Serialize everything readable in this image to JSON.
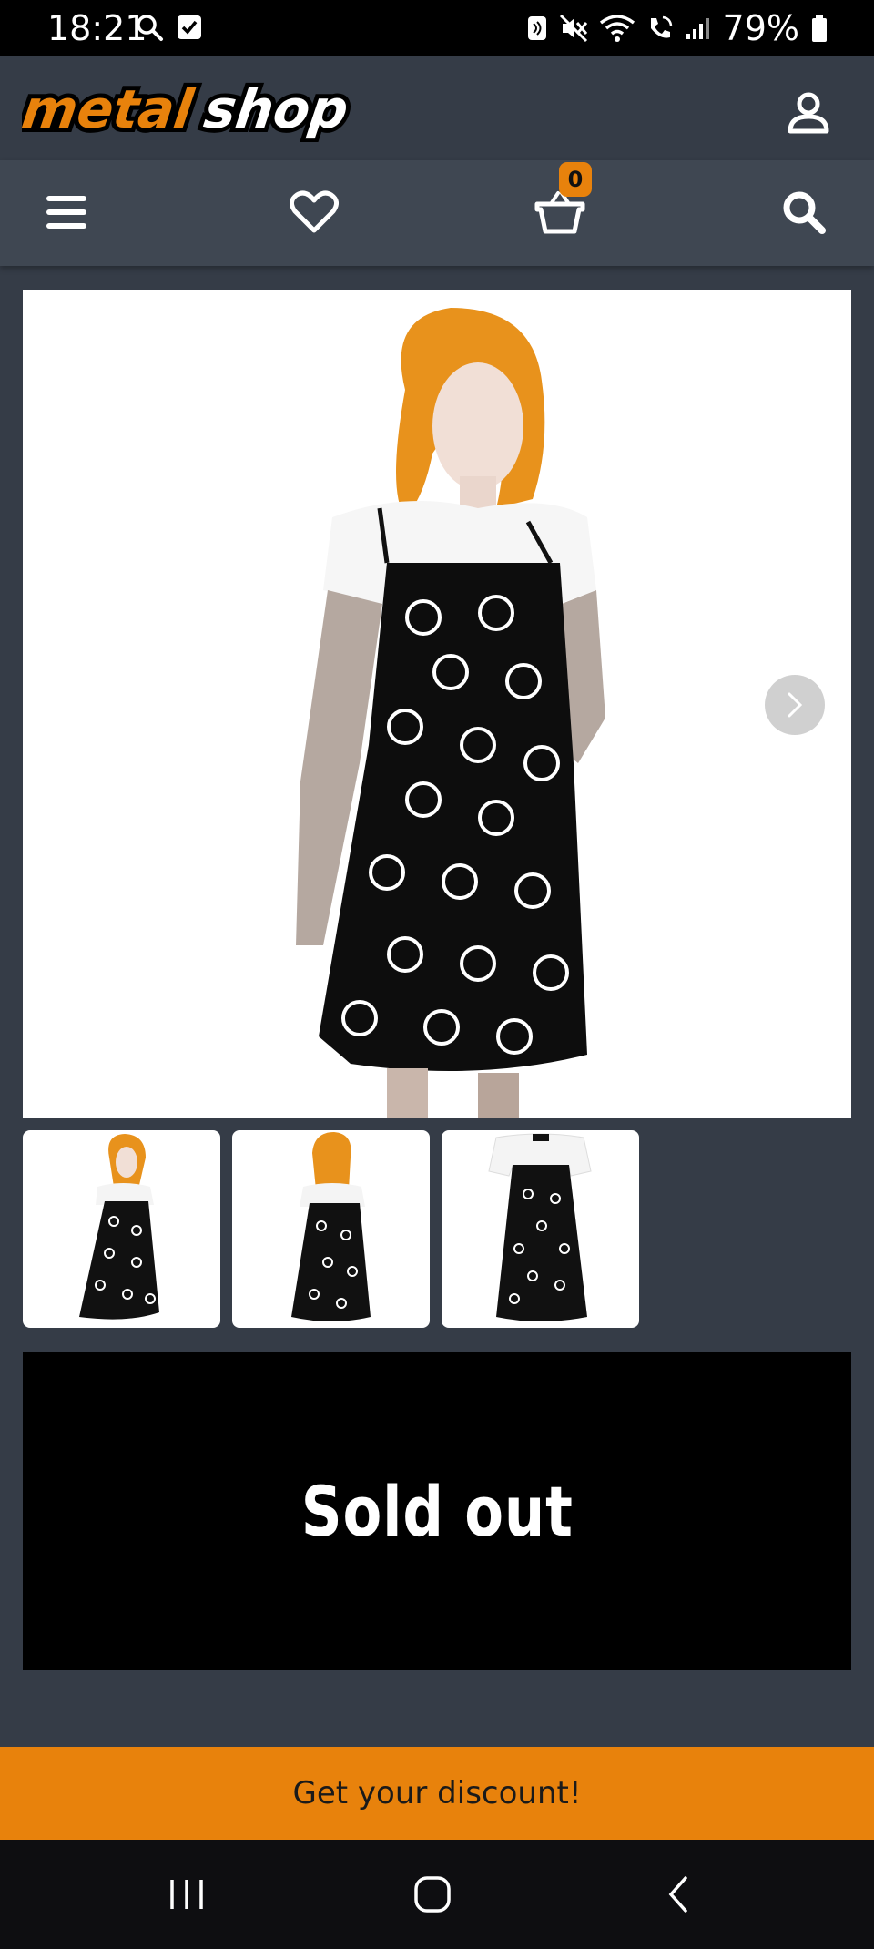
{
  "status": {
    "time": "18:21",
    "battery": "79%"
  },
  "header": {
    "logo_text_a": "metal",
    "logo_text_b": "shop"
  },
  "nav": {
    "cart_count": "0"
  },
  "product": {
    "thumbnails": [
      "front",
      "back",
      "flat"
    ],
    "status_label": "Sold out"
  },
  "promo": {
    "label": "Get your discount!"
  },
  "colors": {
    "accent": "#e8820c",
    "header_bg": "#353c47",
    "nav_bg": "#3f4752"
  }
}
